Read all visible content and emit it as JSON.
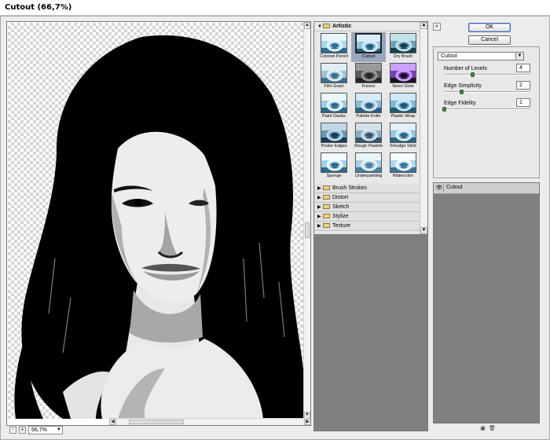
{
  "window": {
    "title": "Cutout (66,7%)"
  },
  "preview": {
    "zoom": "66,7%",
    "zoom_minus": "-",
    "zoom_plus": "+"
  },
  "gallery": {
    "open_category": "Artistic",
    "artistic_filters": [
      "Colored Pencil",
      "Cutout",
      "Dry Brush",
      "Film Grain",
      "Fresco",
      "Neon Glow",
      "Paint Daubs",
      "Palette Knife",
      "Plastic Wrap",
      "Poster Edges",
      "Rough Pastels",
      "Smudge Stick",
      "Sponge",
      "Underpainting",
      "Watercolor"
    ],
    "selected_filter": "Cutout",
    "categories": [
      "Brush Strokes",
      "Distort",
      "Sketch",
      "Stylize",
      "Texture"
    ]
  },
  "buttons": {
    "ok": "OK",
    "cancel": "Cancel",
    "collapse": "«"
  },
  "settings": {
    "filter": "Cutout",
    "params": [
      {
        "label": "Number of Levels",
        "value": "4",
        "pos": 0.33
      },
      {
        "label": "Edge Simplicity",
        "value": "2",
        "pos": 0.2
      },
      {
        "label": "Edge Fidelity",
        "value": "1",
        "pos": 0.0
      }
    ]
  },
  "layers": {
    "items": [
      "Cutout"
    ]
  }
}
